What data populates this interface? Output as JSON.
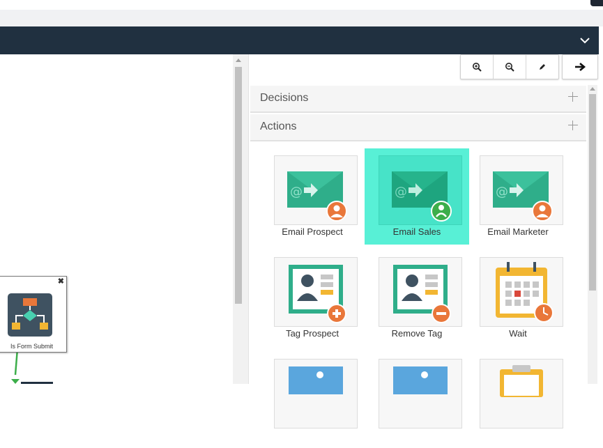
{
  "header": {
    "collapse_icon": "chevron-down-icon"
  },
  "toolbar": {
    "buttons": [
      {
        "icon": "zoom-in-icon"
      },
      {
        "icon": "zoom-out-icon"
      },
      {
        "icon": "pencil-icon"
      }
    ],
    "next_icon": "arrow-right-icon"
  },
  "accordion": {
    "decisions_label": "Decisions",
    "actions_label": "Actions"
  },
  "actions": [
    {
      "label": "Email Prospect",
      "icon": "email-prospect-icon",
      "selected": false
    },
    {
      "label": "Email Sales",
      "icon": "email-sales-icon",
      "selected": true
    },
    {
      "label": "Email Marketer",
      "icon": "email-marketer-icon",
      "selected": false
    },
    {
      "label": "Tag Prospect",
      "icon": "tag-prospect-icon",
      "selected": false
    },
    {
      "label": "Remove Tag",
      "icon": "remove-tag-icon",
      "selected": false
    },
    {
      "label": "Wait",
      "icon": "calendar-clock-icon",
      "selected": false
    }
  ],
  "canvas": {
    "node": {
      "label": "Is Form Submit",
      "close": "✖"
    }
  },
  "colors": {
    "header": "#203040",
    "selected": "#58f0d6",
    "flow": "#3cae4a",
    "email_green": "#2fae8a",
    "badge_orange": "#e9773a"
  }
}
